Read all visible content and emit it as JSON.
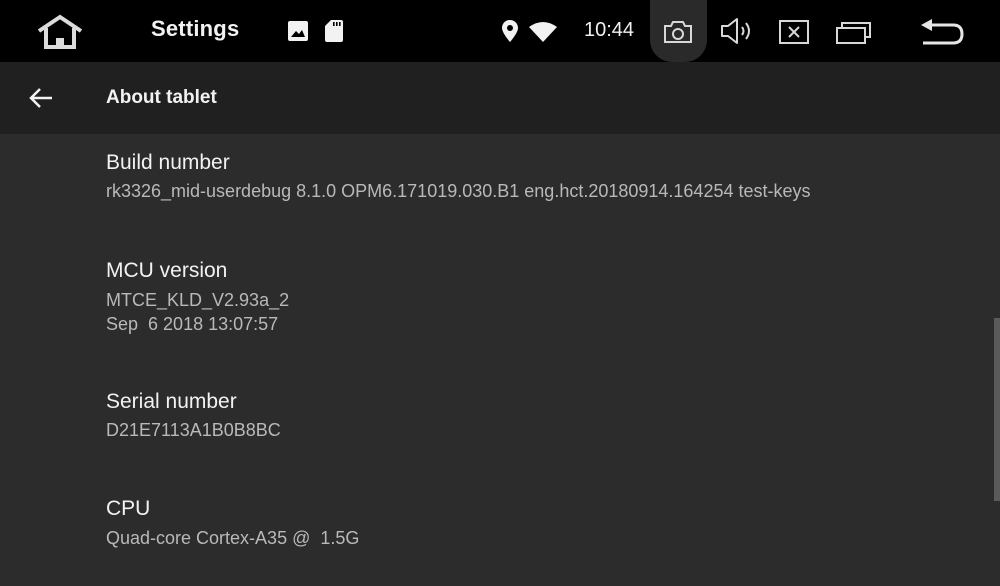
{
  "status_bar": {
    "title": "Settings",
    "time": "10:44",
    "icons": {
      "home": "home-icon",
      "gallery": "image-icon",
      "sd_card": "sd-card-icon",
      "location": "location-icon",
      "wifi": "wifi-icon",
      "screenshot": "camera-icon",
      "volume": "volume-icon",
      "close_app": "close-box-icon",
      "recents": "recent-apps-icon",
      "back": "back-return-icon"
    }
  },
  "toolbar": {
    "back_icon": "arrow-left-icon",
    "title": "About tablet"
  },
  "items": [
    {
      "title": "Build number",
      "summary": "rk3326_mid-userdebug 8.1.0 OPM6.171019.030.B1 eng.hct.20180914.164254 test-keys"
    },
    {
      "title": "MCU version",
      "summary": "MTCE_KLD_V2.93a_2",
      "summary_line2": "Sep  6 2018 13:07:57"
    },
    {
      "title": "Serial number",
      "summary": "D21E7113A1B0B8BC"
    },
    {
      "title": "CPU",
      "summary": "Quad-core Cortex-A35 @  1.5G"
    }
  ],
  "colors": {
    "status_bar_bg": "#000000",
    "toolbar_bg": "#202020",
    "content_bg": "#2c2c2c",
    "primary_text": "#f2f2f2",
    "secondary_text": "#b9b9b9"
  }
}
